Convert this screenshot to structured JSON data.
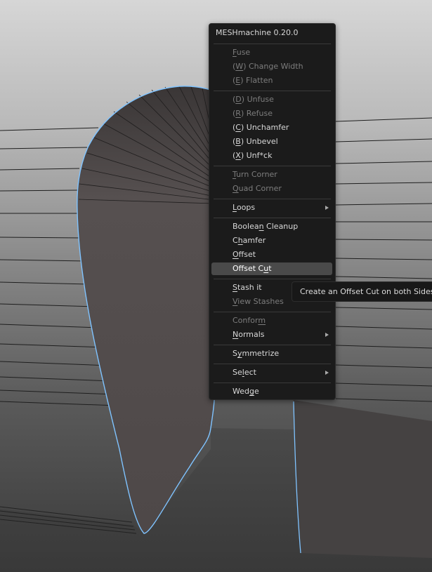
{
  "menu": {
    "title": "MESHmachine 0.20.0",
    "groups": [
      [
        {
          "pre": "",
          "key": "F",
          "post": "use",
          "disabled": true
        },
        {
          "pre": "(",
          "key": "W",
          "post": ") Change Width",
          "disabled": true
        },
        {
          "pre": "(",
          "key": "E",
          "post": ") Flatten",
          "disabled": true
        }
      ],
      [
        {
          "pre": "(",
          "key": "D",
          "post": ") Unfuse",
          "disabled": true
        },
        {
          "pre": "(",
          "key": "R",
          "post": ") Refuse",
          "disabled": true
        },
        {
          "pre": "(",
          "key": "C",
          "post": ") Unchamfer",
          "disabled": false
        },
        {
          "pre": "(",
          "key": "B",
          "post": ") Unbevel",
          "disabled": false
        },
        {
          "pre": "(",
          "key": "X",
          "post": ") Unf*ck",
          "disabled": false
        }
      ],
      [
        {
          "pre": "",
          "key": "T",
          "post": "urn Corner",
          "disabled": true
        },
        {
          "pre": "",
          "key": "Q",
          "post": "uad Corner",
          "disabled": true
        }
      ],
      [
        {
          "pre": "",
          "key": "L",
          "post": "oops",
          "disabled": false,
          "submenu": true
        }
      ],
      [
        {
          "pre": "Boolea",
          "key": "n",
          "post": " Cleanup",
          "disabled": false
        },
        {
          "pre": "C",
          "key": "h",
          "post": "amfer",
          "disabled": false
        },
        {
          "pre": "",
          "key": "O",
          "post": "ffset",
          "disabled": false
        },
        {
          "pre": "Offset C",
          "key": "u",
          "post": "t",
          "disabled": false,
          "highlighted": true
        }
      ],
      [
        {
          "pre": "",
          "key": "S",
          "post": "tash it",
          "disabled": false
        },
        {
          "pre": "",
          "key": "V",
          "post": "iew Stashes",
          "disabled": true
        }
      ],
      [
        {
          "pre": "Confor",
          "key": "m",
          "post": "",
          "disabled": true
        },
        {
          "pre": "",
          "key": "N",
          "post": "ormals",
          "disabled": false,
          "submenu": true
        }
      ],
      [
        {
          "pre": "S",
          "key": "y",
          "post": "mmetrize",
          "disabled": false
        }
      ],
      [
        {
          "pre": "Se",
          "key": "l",
          "post": "ect",
          "disabled": false,
          "submenu": true
        }
      ],
      [
        {
          "pre": "Wed",
          "key": "g",
          "post": "e",
          "disabled": false
        }
      ]
    ]
  },
  "tooltip": {
    "text": "Create an Offset Cut on both Sides of an Edge"
  },
  "colors": {
    "menu_bg": "#1b1b1b",
    "highlight": "#4a4a4a",
    "text": "#d9d9d9",
    "text_disabled": "#7d7d7d",
    "mesh_edge_selected": "#7fc3ff",
    "mesh_face": "#534d4d"
  }
}
